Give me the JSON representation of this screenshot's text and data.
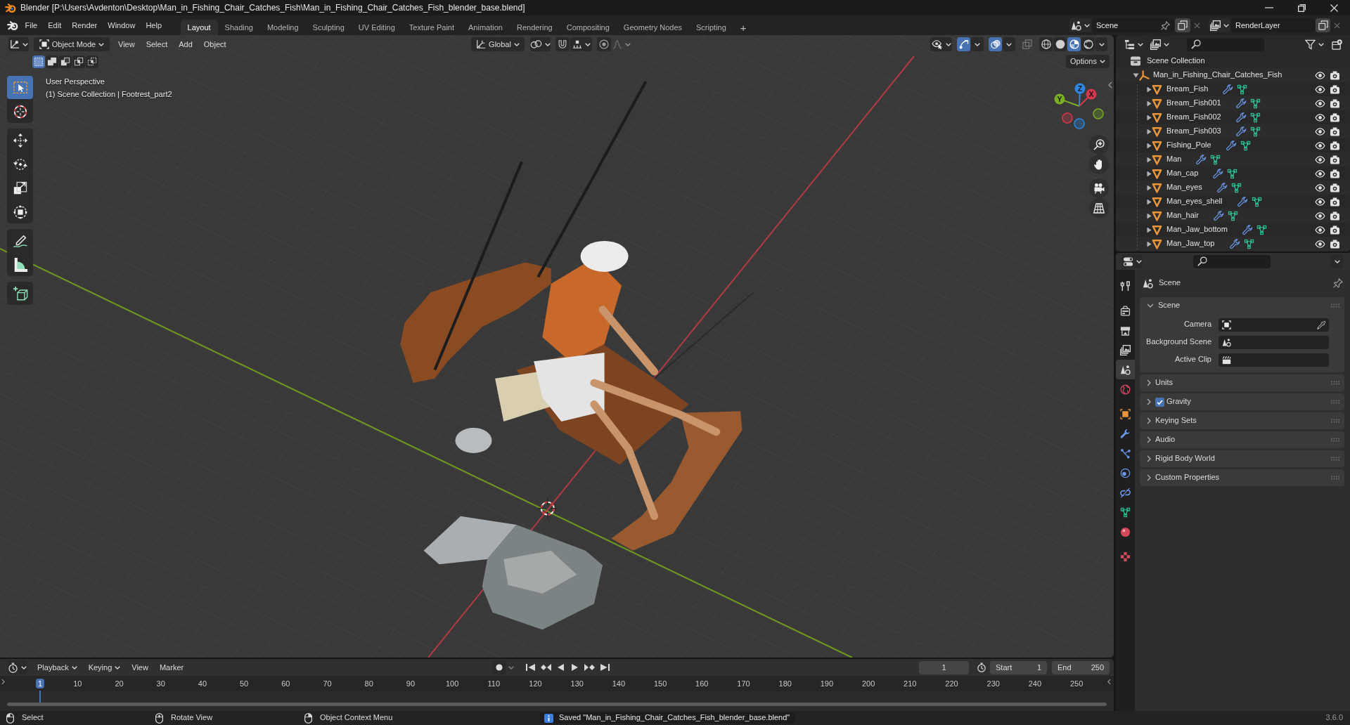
{
  "window": {
    "title": "Blender [P:\\Users\\Avdenton\\Desktop\\Man_in_Fishing_Chair_Catches_Fish\\Man_in_Fishing_Chair_Catches_Fish_blender_base.blend]"
  },
  "menu": [
    "File",
    "Edit",
    "Render",
    "Window",
    "Help"
  ],
  "workspaces": [
    {
      "label": "Layout",
      "selected": true
    },
    {
      "label": "Shading",
      "selected": false
    },
    {
      "label": "Modeling",
      "selected": false
    },
    {
      "label": "Sculpting",
      "selected": false
    },
    {
      "label": "UV Editing",
      "selected": false
    },
    {
      "label": "Texture Paint",
      "selected": false
    },
    {
      "label": "Animation",
      "selected": false
    },
    {
      "label": "Rendering",
      "selected": false
    },
    {
      "label": "Compositing",
      "selected": false
    },
    {
      "label": "Geometry Nodes",
      "selected": false
    },
    {
      "label": "Scripting",
      "selected": false
    }
  ],
  "add_workspace": "+",
  "scene": {
    "value": "Scene"
  },
  "view_layer": {
    "value": "RenderLayer"
  },
  "viewport": {
    "mode": "Object Mode",
    "menus": [
      "View",
      "Select",
      "Add",
      "Object"
    ],
    "orientation": "Global",
    "snap": {
      "on": false
    },
    "proportional": {
      "on": false
    },
    "toggles": [
      {
        "kind": "gizmos",
        "on": true
      },
      {
        "kind": "overlays",
        "on": true
      },
      {
        "kind": "xray",
        "on": false
      }
    ],
    "shading": [
      {
        "kind": "wireframe",
        "selected": false
      },
      {
        "kind": "solid",
        "selected": false
      },
      {
        "kind": "material",
        "selected": true
      },
      {
        "kind": "rendered",
        "selected": false
      }
    ],
    "select_modes": [
      {
        "kind": "set",
        "selected": true
      },
      {
        "kind": "extend",
        "selected": false
      },
      {
        "kind": "subtract",
        "selected": false
      },
      {
        "kind": "difference",
        "selected": false
      },
      {
        "kind": "intersect",
        "selected": false
      }
    ],
    "options": "Options",
    "info": [
      "User Perspective",
      "(1) Scene Collection | Footrest_part2"
    ],
    "tools": [
      {
        "kind": "select",
        "selected": true
      },
      {
        "kind": "cursor",
        "selected": false
      },
      {
        "kind": "move",
        "selected": false
      },
      {
        "kind": "rotate",
        "selected": false
      },
      {
        "kind": "scale",
        "selected": false
      },
      {
        "kind": "transform",
        "selected": false
      },
      {
        "kind": "annotate",
        "selected": false
      },
      {
        "kind": "measure",
        "selected": false
      },
      {
        "kind": "add_cube",
        "selected": false
      }
    ],
    "axes": [
      {
        "label": "X",
        "color": "#d7384d"
      },
      {
        "label": "Y",
        "color": "#7aae24"
      },
      {
        "label": "Z",
        "color": "#2f86e0"
      }
    ]
  },
  "outliner": {
    "root": "Scene Collection",
    "items": [
      {
        "name": "Man_in_Fishing_Chair_Catches_Fish",
        "expanded": true,
        "visible": true,
        "renderable": true,
        "children": [
          {
            "name": "Bream_Fish",
            "expanded": false,
            "visible": true,
            "renderable": true
          },
          {
            "name": "Bream_Fish001",
            "expanded": false,
            "visible": true,
            "renderable": true
          },
          {
            "name": "Bream_Fish002",
            "expanded": false,
            "visible": true,
            "renderable": true
          },
          {
            "name": "Bream_Fish003",
            "expanded": false,
            "visible": true,
            "renderable": true
          },
          {
            "name": "Fishing_Pole",
            "expanded": false,
            "visible": true,
            "renderable": true
          },
          {
            "name": "Man",
            "expanded": false,
            "visible": true,
            "renderable": true
          },
          {
            "name": "Man_cap",
            "expanded": false,
            "visible": true,
            "renderable": true
          },
          {
            "name": "Man_eyes",
            "expanded": false,
            "visible": true,
            "renderable": true
          },
          {
            "name": "Man_eyes_shell",
            "expanded": false,
            "visible": true,
            "renderable": true
          },
          {
            "name": "Man_hair",
            "expanded": false,
            "visible": true,
            "renderable": true
          },
          {
            "name": "Man_Jaw_bottom",
            "expanded": false,
            "visible": true,
            "renderable": true
          },
          {
            "name": "Man_Jaw_top",
            "expanded": false,
            "visible": true,
            "renderable": true
          }
        ]
      }
    ]
  },
  "properties": {
    "tabs": [
      {
        "kind": "tool",
        "selected": false
      },
      {
        "kind": "render",
        "selected": false
      },
      {
        "kind": "output",
        "selected": false
      },
      {
        "kind": "view_layer",
        "selected": false
      },
      {
        "kind": "scene",
        "selected": true
      },
      {
        "kind": "world",
        "selected": false
      },
      {
        "kind": "object",
        "selected": false
      },
      {
        "kind": "modifiers",
        "selected": false
      },
      {
        "kind": "particles",
        "selected": false
      },
      {
        "kind": "physics",
        "selected": false
      },
      {
        "kind": "constraints",
        "selected": false
      },
      {
        "kind": "data",
        "selected": false
      },
      {
        "kind": "material",
        "selected": false
      },
      {
        "kind": "texture",
        "selected": false
      }
    ],
    "context": "Scene",
    "panels": [
      {
        "title": "Scene",
        "expanded": true,
        "fields": [
          {
            "label": "Camera",
            "kind": "camera"
          },
          {
            "label": "Background Scene",
            "kind": "scene"
          },
          {
            "label": "Active Clip",
            "kind": "clip"
          }
        ]
      },
      {
        "title": "Units",
        "expanded": false
      },
      {
        "title": "Gravity",
        "expanded": false,
        "checked": true
      },
      {
        "title": "Keying Sets",
        "expanded": false
      },
      {
        "title": "Audio",
        "expanded": false
      },
      {
        "title": "Rigid Body World",
        "expanded": false
      },
      {
        "title": "Custom Properties",
        "expanded": false
      }
    ]
  },
  "timeline": {
    "menus": [
      {
        "label": "Playback",
        "kind": "dropdown"
      },
      {
        "label": "Keying",
        "kind": "dropdown"
      },
      {
        "label": "View",
        "kind": "menu"
      },
      {
        "label": "Marker",
        "kind": "menu"
      }
    ],
    "frame": "1",
    "start": {
      "label": "Start",
      "value": "1"
    },
    "end": {
      "label": "End",
      "value": "250"
    },
    "ruler": [
      {
        "label": "1",
        "selected": true
      },
      {
        "label": "10",
        "selected": false
      },
      {
        "label": "20",
        "selected": false
      },
      {
        "label": "30",
        "selected": false
      },
      {
        "label": "40",
        "selected": false
      },
      {
        "label": "50",
        "selected": false
      },
      {
        "label": "60",
        "selected": false
      },
      {
        "label": "70",
        "selected": false
      },
      {
        "label": "80",
        "selected": false
      },
      {
        "label": "90",
        "selected": false
      },
      {
        "label": "100",
        "selected": false
      },
      {
        "label": "110",
        "selected": false
      },
      {
        "label": "120",
        "selected": false
      },
      {
        "label": "130",
        "selected": false
      },
      {
        "label": "140",
        "selected": false
      },
      {
        "label": "150",
        "selected": false
      },
      {
        "label": "160",
        "selected": false
      },
      {
        "label": "170",
        "selected": false
      },
      {
        "label": "180",
        "selected": false
      },
      {
        "label": "190",
        "selected": false
      },
      {
        "label": "200",
        "selected": false
      },
      {
        "label": "210",
        "selected": false
      },
      {
        "label": "220",
        "selected": false
      },
      {
        "label": "230",
        "selected": false
      },
      {
        "label": "240",
        "selected": false
      },
      {
        "label": "250",
        "selected": false
      }
    ]
  },
  "status_bar": {
    "hints": [
      "Select",
      "Rotate View",
      "Object Context Menu"
    ],
    "message": "Saved \"Man_in_Fishing_Chair_Catches_Fish_blender_base.blend\"",
    "version": "3.6.0"
  }
}
